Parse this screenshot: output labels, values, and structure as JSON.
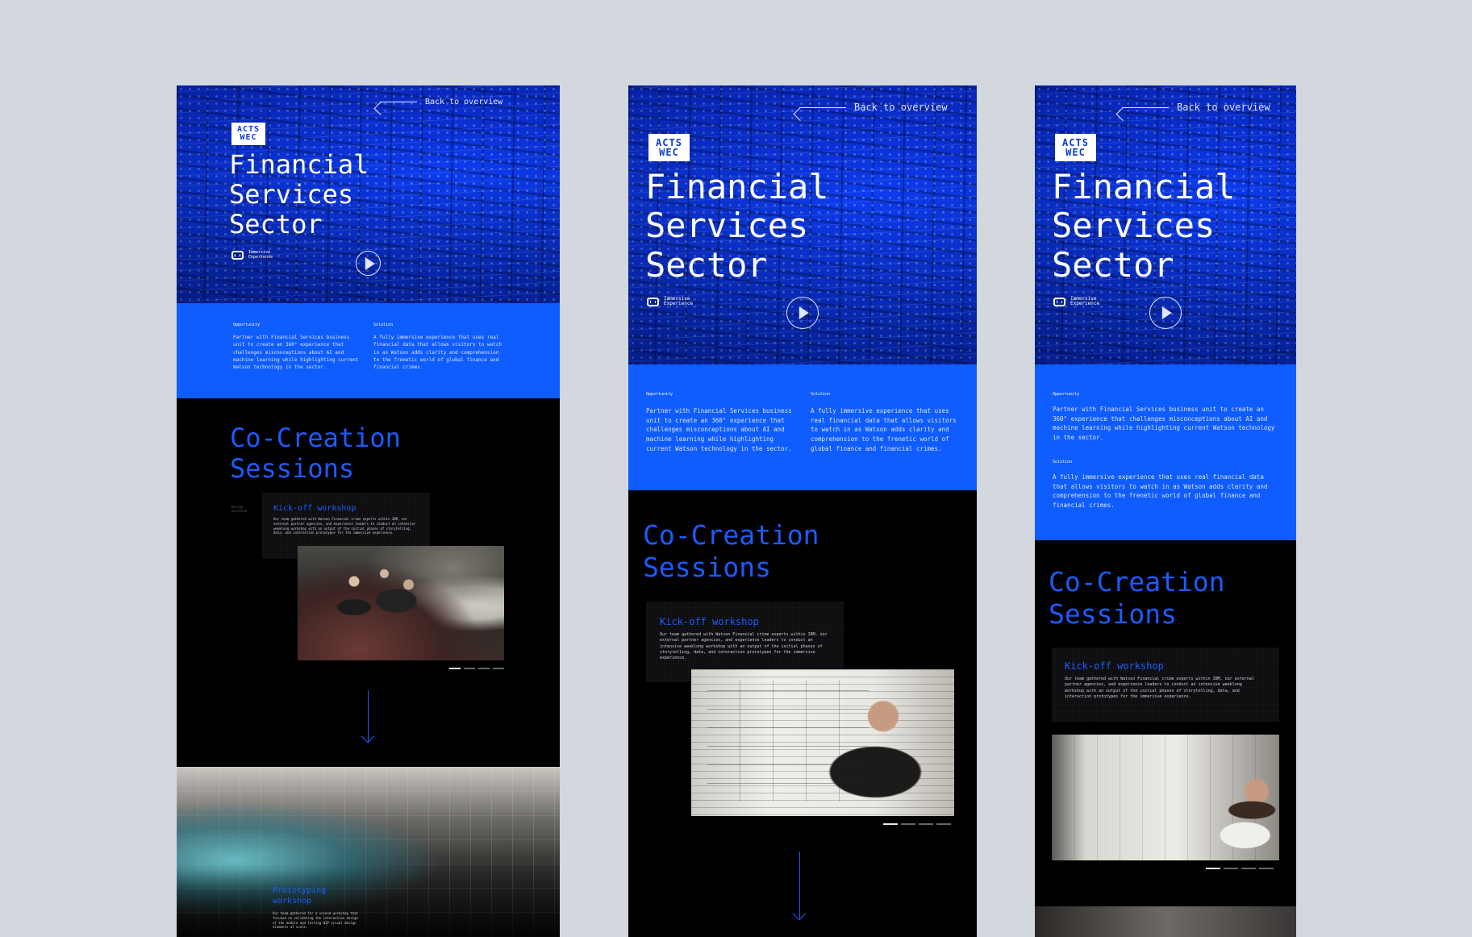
{
  "back_label": "Back to overview",
  "logo": {
    "line1": "ACTS",
    "line2": "WEC"
  },
  "title": {
    "line1": "Financial",
    "line2": "Services",
    "line3": "Sector"
  },
  "immersive": {
    "line1": "Immersive",
    "line2": "Experience"
  },
  "opportunity": {
    "label": "Opportunity",
    "text": "Partner with Financial Services business unit to create an 360° experience that challenges misconceptions about AI and machine learning while highlighting current Watson technology in the sector."
  },
  "solution": {
    "label": "Solution",
    "text": "A fully immersive experience that uses real financial data that allows visitors to watch in as Watson adds clarity and comprehension to the frenetic world of global finance and financial crimes."
  },
  "section_title": {
    "line1": "Co-Creation",
    "line2": "Sessions"
  },
  "side_label": {
    "line1": "Design",
    "line2": "workshop"
  },
  "kickoff": {
    "title": "Kick-off workshop",
    "text": "Our team gathered with Watson Financial crime experts within IBM, our external partner agencies, and experience leaders to conduct an intensive weeklong workshop with an output of the initial phases of storytelling, data, and interaction prototypes for the immersive experience."
  },
  "prototyping": {
    "title_line1": "Prototyping",
    "title_line2": "workshop",
    "text": "Our team gathered for a second workshop that focused on validating the interaction design of the module and testing WIP visual design elements at scale."
  },
  "colors": {
    "background": "#d3d8de",
    "brand_blue": "#0f5cff",
    "accent_text": "#1d5bff",
    "frame": "#000000"
  }
}
